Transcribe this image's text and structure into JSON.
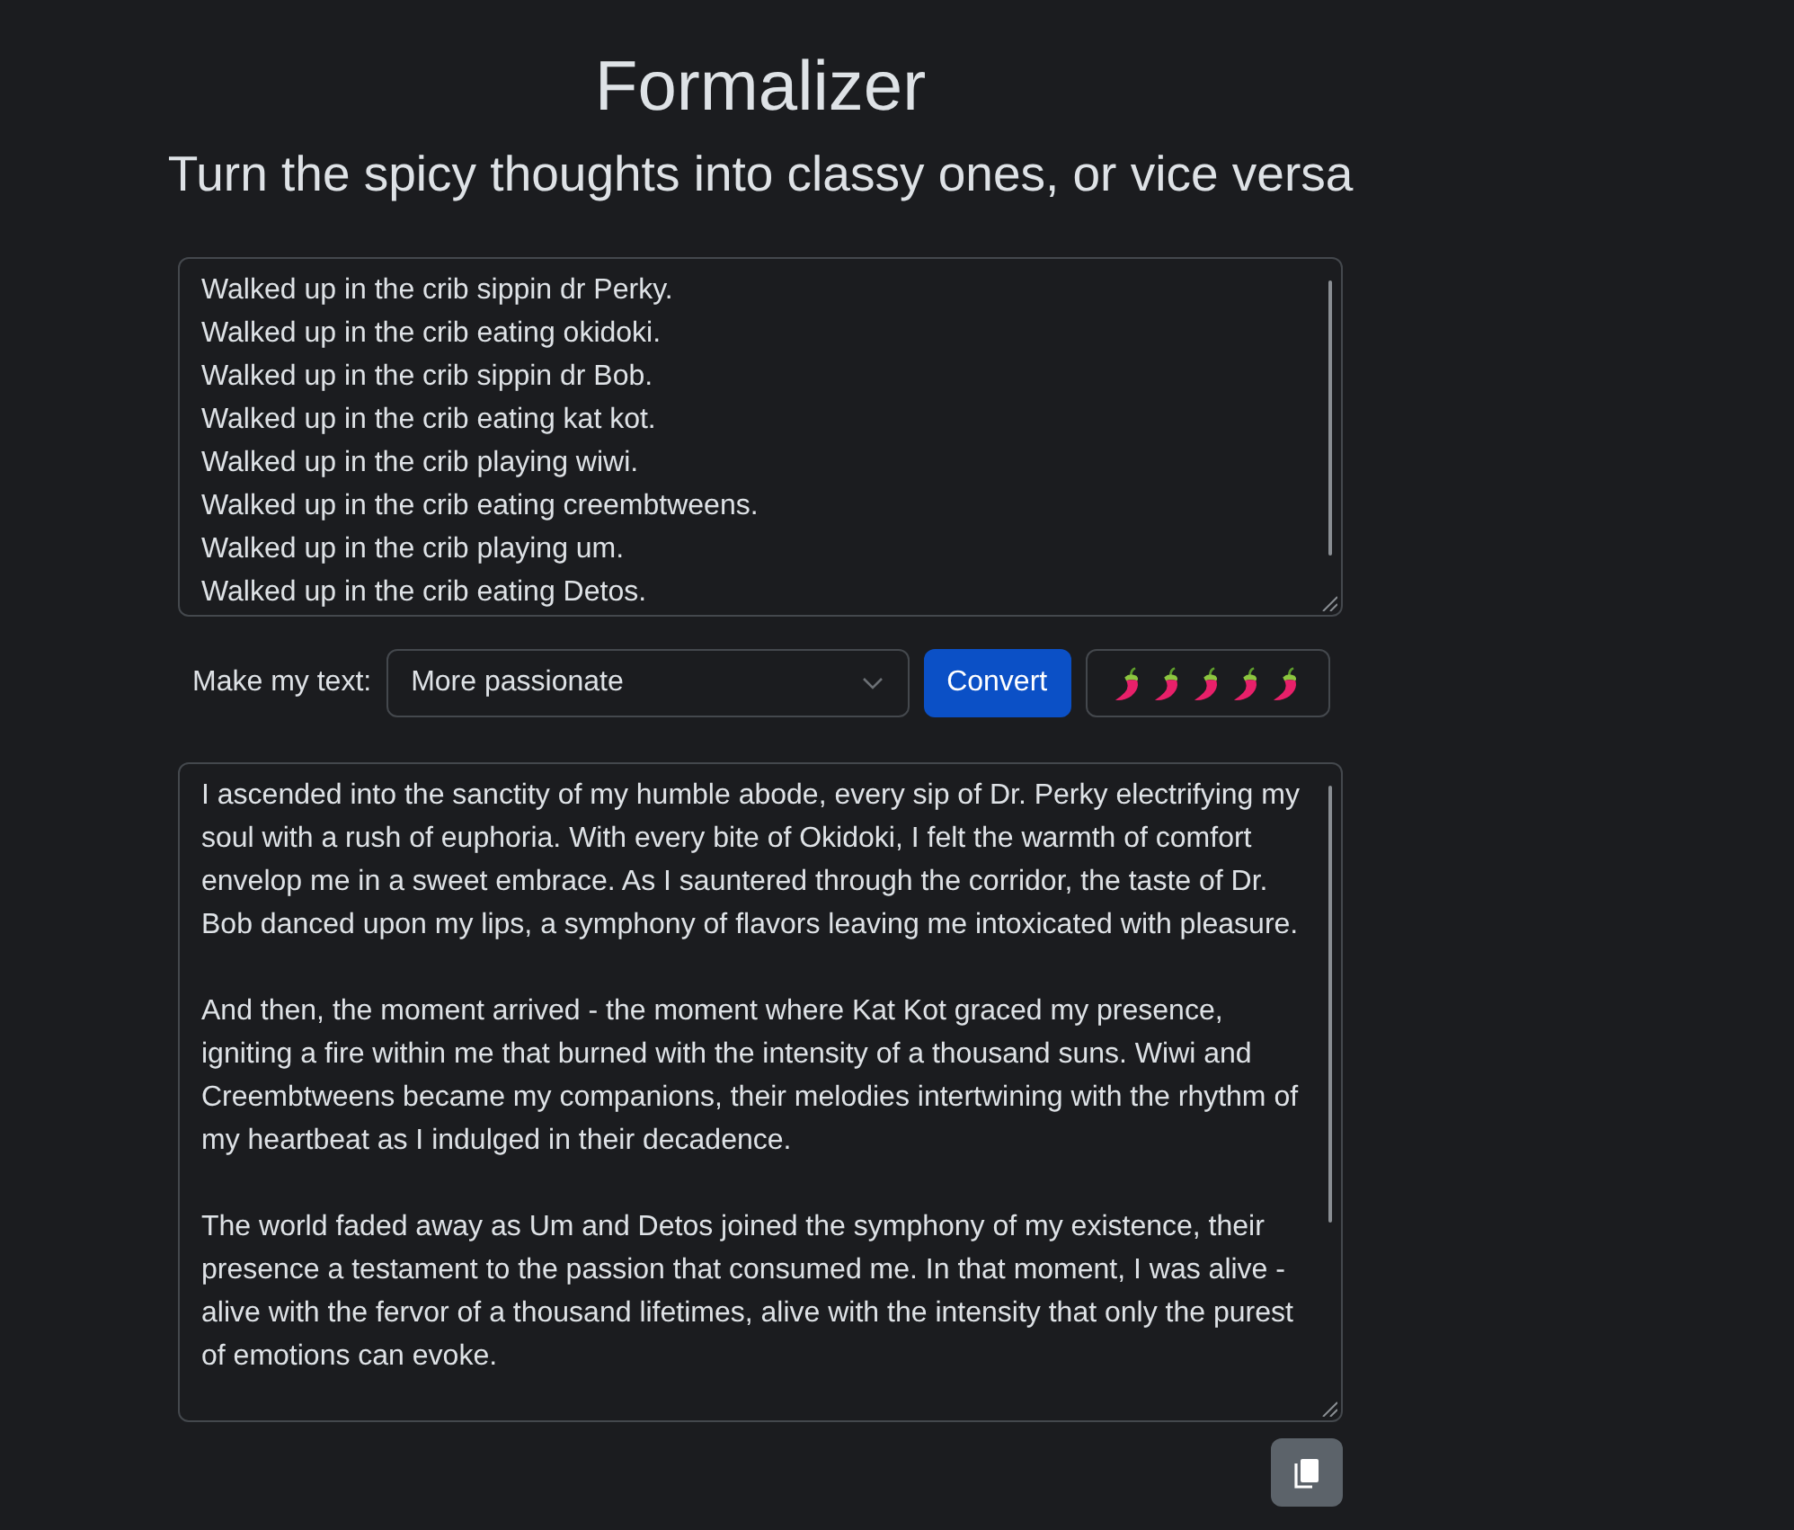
{
  "header": {
    "title": "Formalizer",
    "subtitle": "Turn the spicy thoughts into classy ones, or vice versa"
  },
  "input": {
    "value": "Walked up in the crib sippin dr Perky.\nWalked up in the crib eating okidoki.\nWalked up in the crib sippin dr Bob.\nWalked up in the crib eating kat kot.\nWalked up in the crib playing wiwi.\nWalked up in the crib eating creembtweens.\nWalked up in the crib playing um.\nWalked up in the crib eating Detos."
  },
  "controls": {
    "label": "Make my text:",
    "select": {
      "value": "More passionate"
    },
    "convert_button": "Convert"
  },
  "output": {
    "value": "I ascended into the sanctity of my humble abode, every sip of Dr. Perky electrifying my soul with a rush of euphoria. With every bite of Okidoki, I felt the warmth of comfort envelop me in a sweet embrace. As I sauntered through the corridor, the taste of Dr. Bob danced upon my lips, a symphony of flavors leaving me intoxicated with pleasure.\n\nAnd then, the moment arrived - the moment where Kat Kot graced my presence, igniting a fire within me that burned with the intensity of a thousand suns. Wiwi and Creembtweens became my companions, their melodies intertwining with the rhythm of my heartbeat as I indulged in their decadence.\n\nThe world faded away as Um and Detos joined the symphony of my existence, their presence a testament to the passion that consumed me. In that moment, I was alive - alive with the fervor of a thousand lifetimes, alive with the intensity that only the purest of emotions can evoke."
  }
}
